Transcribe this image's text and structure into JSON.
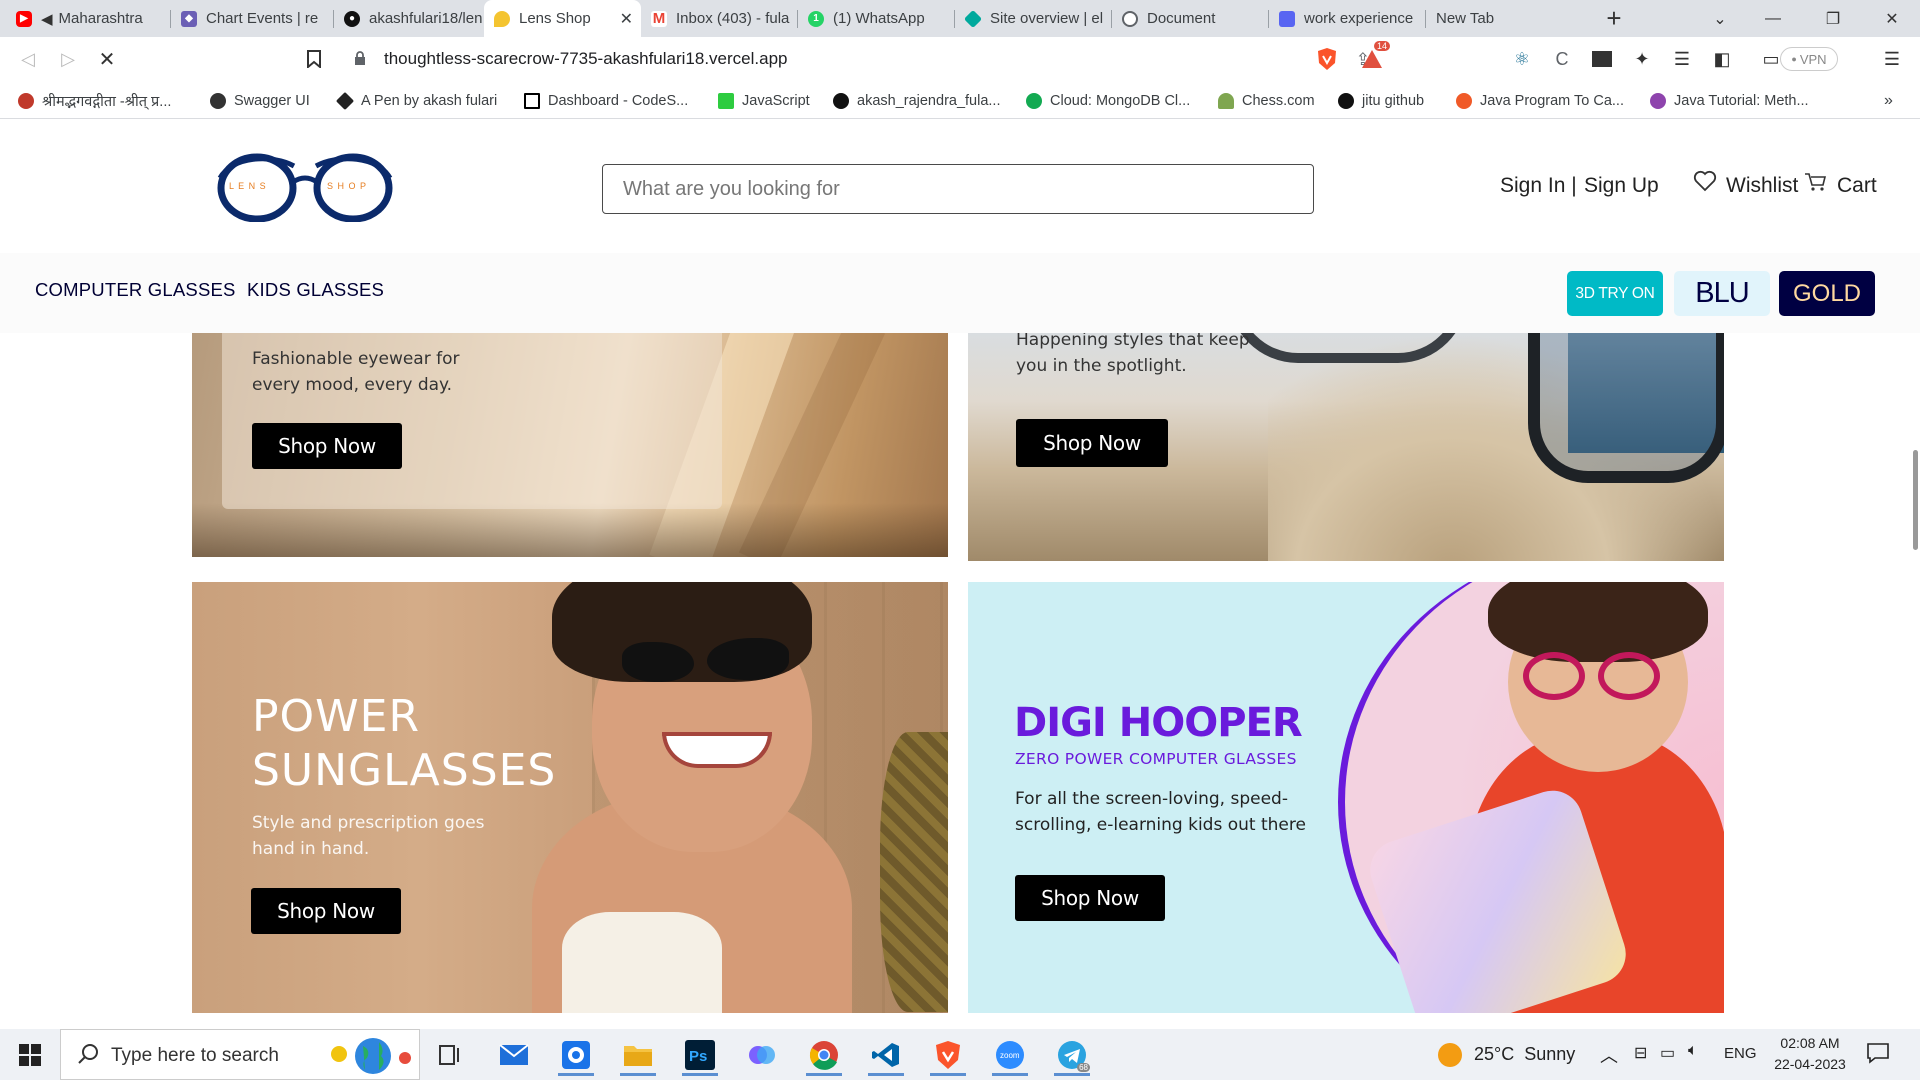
{
  "browser": {
    "tabs": [
      {
        "label": "Maharashtra",
        "icon": "youtube-icon",
        "color": "#ff0000"
      },
      {
        "label": "Chart Events | re",
        "icon": "chart-icon",
        "color": "#6b5fb5"
      },
      {
        "label": "akashfulari18/len",
        "icon": "github-icon",
        "color": "#111111"
      },
      {
        "label": "Lens Shop",
        "icon": "lens-shop-icon",
        "color": "#e0a800"
      },
      {
        "label": "Inbox (403) - fula",
        "icon": "gmail-icon",
        "color": "#ea4335"
      },
      {
        "label": "(1) WhatsApp",
        "icon": "whatsapp-icon",
        "color": "#25d366"
      },
      {
        "label": "Site overview | el",
        "icon": "diamond-icon",
        "color": "#00a99d"
      },
      {
        "label": "Document",
        "icon": "globe-icon",
        "color": "#5f6368"
      },
      {
        "label": "work experience",
        "icon": "notes-icon",
        "color": "#5865f2"
      },
      {
        "label": "New Tab",
        "icon": "",
        "color": ""
      }
    ],
    "url": "thoughtless-scarecrow-7735-akashfulari18.vercel.app",
    "vpn_label": "VPN",
    "brave_badge": "14",
    "bookmarks": [
      {
        "label": "श्रीमद्भगवद्गीता -श्रीत् प्र...",
        "color": "#c0392b"
      },
      {
        "label": "Swagger UI",
        "color": "#333333"
      },
      {
        "label": "A Pen by akash fulari",
        "color": "#222222"
      },
      {
        "label": "Dashboard - CodeS...",
        "color": "#000000"
      },
      {
        "label": "JavaScript",
        "color": "#2ecc40"
      },
      {
        "label": "akash_rajendra_fula...",
        "color": "#111111"
      },
      {
        "label": "Cloud: MongoDB Cl...",
        "color": "#13aa52"
      },
      {
        "label": "Chess.com",
        "color": "#7fa650"
      },
      {
        "label": "jitu github",
        "color": "#111111"
      },
      {
        "label": "Java Program To Ca...",
        "color": "#f05a28"
      },
      {
        "label": "Java Tutorial: Meth...",
        "color": "#8e44ad"
      }
    ]
  },
  "site": {
    "logo_left": "L E N S",
    "logo_right": "S H O P",
    "search_placeholder": "What are you looking for",
    "sign_in": "Sign In |",
    "sign_up": "Sign Up",
    "wishlist": "Wishlist",
    "cart": "Cart",
    "nav": [
      "COMPUTER GLASSES",
      "KIDS GLASSES"
    ],
    "try_on": "3D TRY ON",
    "blu": "BLU",
    "gold": "GOLD",
    "colors": {
      "navy": "#000042",
      "teal": "#00bac6",
      "blu_bg": "#e1f4fb"
    }
  },
  "banners": {
    "top_left": {
      "subtitle_1": "Fashionable eyewear for",
      "subtitle_2": "every mood, every day.",
      "cta": "Shop Now"
    },
    "top_right": {
      "subtitle_1": "Happening styles that keep",
      "subtitle_2": "you in the spotlight.",
      "cta": "Shop Now"
    },
    "bottom_left": {
      "title_1": "POWER",
      "title_2": "SUNGLASSES",
      "subtitle_1": "Style and prescription goes",
      "subtitle_2": "hand in hand.",
      "cta": "Shop Now"
    },
    "bottom_right": {
      "title": "DIGI HOOPER",
      "subtitle": "ZERO POWER COMPUTER GLASSES",
      "body_1": "For all the screen-loving, speed-",
      "body_2": "scrolling, e-learning kids out there",
      "cta": "Shop Now"
    }
  },
  "taskbar": {
    "search_placeholder": "Type here to search",
    "weather": "25°C  Sunny",
    "lang": "ENG",
    "time": "02:08 AM",
    "date": "22-04-2023",
    "telegram_badge": "68"
  }
}
